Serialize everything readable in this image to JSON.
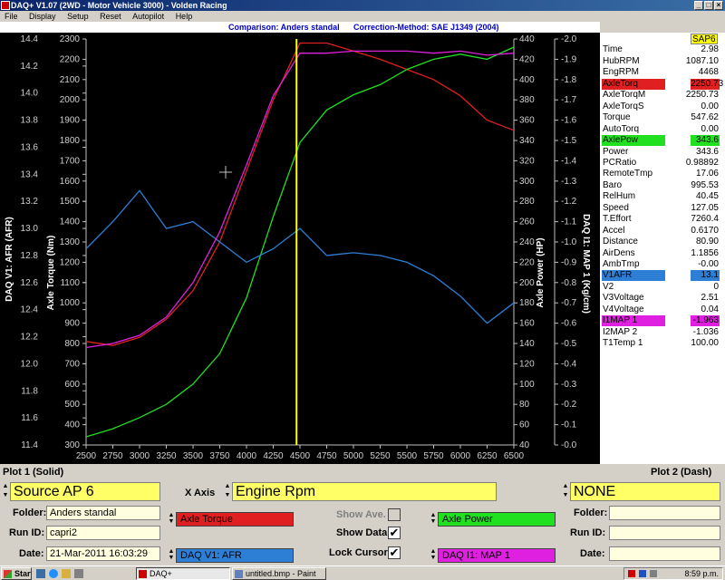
{
  "window": {
    "title": "DAQ+ V1.07 (2WD - Motor Vehicle 3000) - Volden Racing",
    "min_label": "_",
    "max_label": "□",
    "close_label": "×"
  },
  "menu": [
    "File",
    "Display",
    "Setup",
    "Reset",
    "Autopilot",
    "Help"
  ],
  "header": {
    "comparison": "Comparison: Anders standal",
    "correction": "Correction-Method: SAE J1349 (2004)"
  },
  "chart_data": {
    "type": "line",
    "x": [
      2500,
      2750,
      3000,
      3250,
      3500,
      3750,
      4000,
      4250,
      4500,
      4750,
      5000,
      5250,
      5500,
      5750,
      6000,
      6250,
      6500
    ],
    "xlim": [
      2500,
      6500
    ],
    "x_ticks": [
      "2500",
      "2750",
      "3000",
      "3250",
      "3500",
      "3750",
      "4000",
      "4250",
      "4500",
      "4750",
      "5000",
      "5250",
      "5500",
      "5750",
      "6000",
      "6250",
      "6500"
    ],
    "axes": {
      "afr": {
        "label": "DAQ V1: AFR (AFR)",
        "range": [
          11.4,
          14.4
        ],
        "ticks": [
          "11.4",
          "11.6",
          "11.8",
          "12.0",
          "12.2",
          "12.4",
          "12.6",
          "12.8",
          "13.0",
          "13.2",
          "13.4",
          "13.6",
          "13.8",
          "14.0",
          "14.2",
          "14.4"
        ]
      },
      "torque": {
        "label": "Axle Torque (Nm)",
        "range": [
          300,
          2300
        ],
        "ticks": [
          "300",
          "400",
          "500",
          "600",
          "700",
          "800",
          "900",
          "1000",
          "1100",
          "1200",
          "1300",
          "1400",
          "1500",
          "1600",
          "1700",
          "1800",
          "1900",
          "2000",
          "2100",
          "2200",
          "2300"
        ]
      },
      "power": {
        "label": "Axle Power (HP)",
        "range": [
          40,
          440
        ],
        "ticks": [
          "40",
          "60",
          "80",
          "100",
          "120",
          "140",
          "160",
          "180",
          "200",
          "220",
          "240",
          "260",
          "280",
          "300",
          "320",
          "340",
          "360",
          "380",
          "400",
          "420",
          "440"
        ]
      },
      "map": {
        "label": "DAQ I1: MAP 1 (Kg/cm)",
        "range": [
          -0.0,
          -2.0
        ],
        "ticks": [
          "-0.0",
          "-0.1",
          "-0.2",
          "-0.3",
          "-0.4",
          "-0.5",
          "-0.6",
          "-0.7",
          "-0.8",
          "-0.9",
          "-1.0",
          "-1.1",
          "-1.2",
          "-1.3",
          "-1.4",
          "-1.5",
          "-1.6",
          "-1.7",
          "-1.8",
          "-1.9",
          "-2.0"
        ]
      }
    },
    "series": [
      {
        "name": "Axle Torque",
        "axis": "torque",
        "color": "#e02020",
        "values": [
          810,
          790,
          830,
          920,
          1060,
          1300,
          1650,
          2000,
          2280,
          2280,
          2240,
          2200,
          2150,
          2100,
          2020,
          1900,
          1850
        ]
      },
      {
        "name": "Axle Power",
        "axis": "power",
        "color": "#20e020",
        "values": [
          48,
          56,
          67,
          80,
          100,
          130,
          185,
          265,
          338,
          370,
          385,
          395,
          410,
          420,
          425,
          420,
          432
        ]
      },
      {
        "name": "DAQ V1: AFR",
        "axis": "afr",
        "color": "#2d7fd6",
        "values": [
          12.85,
          13.05,
          13.28,
          13.0,
          13.05,
          12.9,
          12.75,
          12.85,
          13.0,
          12.8,
          12.82,
          12.8,
          12.75,
          12.65,
          12.5,
          12.3,
          12.45
        ]
      },
      {
        "name": "DAQ I1: MAP 1",
        "axis": "map",
        "color": "#e020e0",
        "values": [
          -0.48,
          -0.5,
          -0.54,
          -0.63,
          -0.8,
          -1.05,
          -1.38,
          -1.72,
          -1.93,
          -1.93,
          -1.94,
          -1.94,
          -1.94,
          -1.93,
          -1.94,
          -1.92,
          -1.93
        ]
      }
    ],
    "cursor_x": 4468,
    "cursor_color": "#ffff00",
    "grid": false
  },
  "channels": [
    {
      "name": "SAP6",
      "value": "",
      "name_bg": "",
      "value_bg": "#ffff00",
      "header": true
    },
    {
      "name": "Time",
      "value": "2.98"
    },
    {
      "name": "HubRPM",
      "value": "1087.10"
    },
    {
      "name": "EngRPM",
      "value": "4468"
    },
    {
      "name": "AxleTorq",
      "value": "2250.73",
      "name_bg": "#e02020",
      "value_bg": "#e02020"
    },
    {
      "name": "AxleTorqM",
      "value": "2250.73"
    },
    {
      "name": "AxleTorqS",
      "value": "0.00"
    },
    {
      "name": "Torque",
      "value": "547.62"
    },
    {
      "name": "AutoTorq",
      "value": "0.00"
    },
    {
      "name": "AxlePow",
      "value": "343.6",
      "name_bg": "#20e020",
      "value_bg": "#20e020"
    },
    {
      "name": "Power",
      "value": "343.6"
    },
    {
      "name": "PCRatio",
      "value": "0.98892"
    },
    {
      "name": "RemoteTmp",
      "value": "17.06"
    },
    {
      "name": "Baro",
      "value": "995.53"
    },
    {
      "name": "RelHum",
      "value": "40.45"
    },
    {
      "name": "Speed",
      "value": "127.05"
    },
    {
      "name": "T.Effort",
      "value": "7260.4"
    },
    {
      "name": "Accel",
      "value": "0.6170"
    },
    {
      "name": "Distance",
      "value": "80.90"
    },
    {
      "name": "AirDens",
      "value": "1.1856"
    },
    {
      "name": "AmbTmp",
      "value": "-0.00"
    },
    {
      "name": "V1AFR",
      "value": "13.1",
      "name_bg": "#2d7fd6",
      "value_bg": "#2d7fd6"
    },
    {
      "name": "V2",
      "value": "0"
    },
    {
      "name": "V3Voltage",
      "value": "2.51"
    },
    {
      "name": "V4Voltage",
      "value": "0.04"
    },
    {
      "name": "I1MAP 1",
      "value": "-1.963",
      "name_bg": "#e020e0",
      "value_bg": "#e020e0"
    },
    {
      "name": "I2MAP 2",
      "value": "-1.036"
    },
    {
      "name": "T1Temp 1",
      "value": "100.00"
    }
  ],
  "plot1": {
    "title": "Plot 1 (Solid)",
    "source": "Source AP 6",
    "folder_label": "Folder:",
    "folder": "Anders standal",
    "runid_label": "Run ID:",
    "runid": "capri2",
    "date_label": "Date:",
    "date": "21-Mar-2011 16:03:29"
  },
  "xaxis": {
    "label": "X Axis",
    "value": "Engine Rpm"
  },
  "selectors": {
    "left_top": {
      "label": "Axle Torque",
      "color": "#e02020"
    },
    "left_bottom": {
      "label": "DAQ V1: AFR",
      "color": "#2d7fd6"
    },
    "right_top": {
      "label": "Axle Power",
      "color": "#20e020"
    },
    "right_bottom": {
      "label": "DAQ I1: MAP 1",
      "color": "#e020e0"
    }
  },
  "options": {
    "show_ave": {
      "label": "Show Ave.",
      "checked": false
    },
    "show_data": {
      "label": "Show Data",
      "checked": true
    },
    "lock_cursor": {
      "label": "Lock Cursor",
      "checked": true
    },
    "check_mark": "✔"
  },
  "plot2": {
    "title": "Plot 2 (Dash)",
    "source": "NONE",
    "folder_label": "Folder:",
    "runid_label": "Run ID:",
    "date_label": "Date:"
  },
  "taskbar": {
    "start": "Start",
    "tasks": [
      "DAQ+",
      "untitled.bmp - Paint"
    ],
    "clock": "8:59 p.m."
  }
}
